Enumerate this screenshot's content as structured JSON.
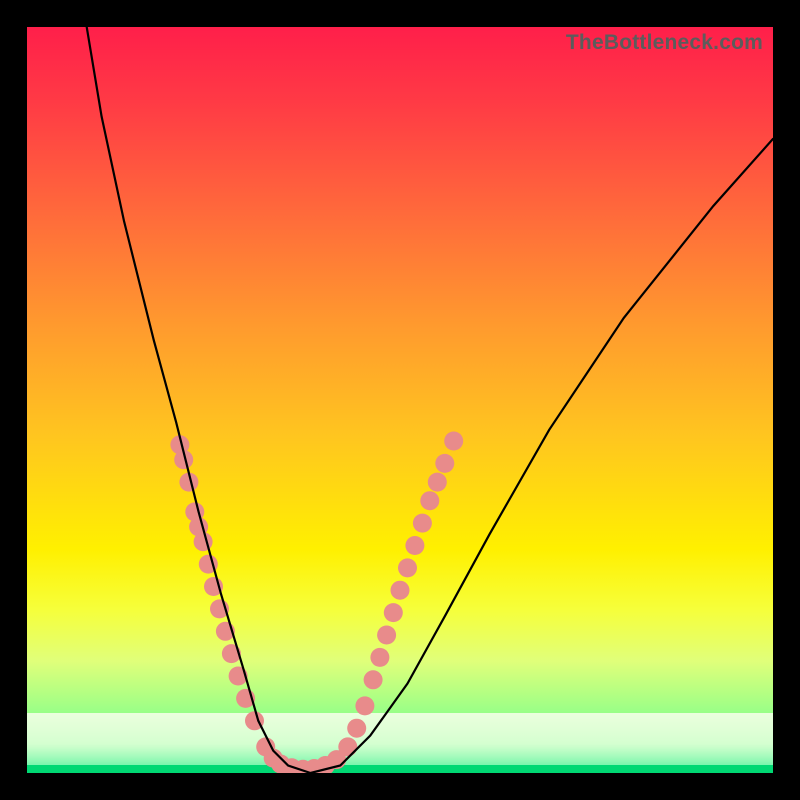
{
  "watermark": {
    "text": "TheBottleneck.com"
  },
  "chart_data": {
    "type": "line",
    "title": "",
    "xlabel": "",
    "ylabel": "",
    "xlim": [
      0,
      100
    ],
    "ylim": [
      0,
      100
    ],
    "grid": false,
    "legend": false,
    "series": [
      {
        "name": "bottleneck-curve",
        "x": [
          8,
          10,
          13,
          17,
          20,
          23,
          26,
          29,
          31,
          33,
          35,
          38,
          42,
          46,
          51,
          56,
          62,
          70,
          80,
          92,
          100
        ],
        "values": [
          100,
          88,
          74,
          58,
          47,
          35,
          24,
          14,
          7,
          3,
          1,
          0,
          1,
          5,
          12,
          21,
          32,
          46,
          61,
          76,
          85
        ]
      }
    ],
    "markers": {
      "name": "highlight-dots",
      "color": "#e88b8b",
      "points": [
        {
          "x": 20.5,
          "y": 44
        },
        {
          "x": 21.0,
          "y": 42
        },
        {
          "x": 21.7,
          "y": 39
        },
        {
          "x": 22.5,
          "y": 35
        },
        {
          "x": 23.0,
          "y": 33
        },
        {
          "x": 23.6,
          "y": 31
        },
        {
          "x": 24.3,
          "y": 28
        },
        {
          "x": 25.0,
          "y": 25
        },
        {
          "x": 25.8,
          "y": 22
        },
        {
          "x": 26.6,
          "y": 19
        },
        {
          "x": 27.4,
          "y": 16
        },
        {
          "x": 28.3,
          "y": 13
        },
        {
          "x": 29.3,
          "y": 10
        },
        {
          "x": 30.5,
          "y": 7
        },
        {
          "x": 32.0,
          "y": 3.5
        },
        {
          "x": 33.0,
          "y": 2.0
        },
        {
          "x": 34.0,
          "y": 1.2
        },
        {
          "x": 35.5,
          "y": 0.7
        },
        {
          "x": 37.0,
          "y": 0.5
        },
        {
          "x": 38.5,
          "y": 0.6
        },
        {
          "x": 40.0,
          "y": 1.0
        },
        {
          "x": 41.5,
          "y": 1.8
        },
        {
          "x": 43.0,
          "y": 3.5
        },
        {
          "x": 44.2,
          "y": 6.0
        },
        {
          "x": 45.3,
          "y": 9.0
        },
        {
          "x": 46.4,
          "y": 12.5
        },
        {
          "x": 47.3,
          "y": 15.5
        },
        {
          "x": 48.2,
          "y": 18.5
        },
        {
          "x": 49.1,
          "y": 21.5
        },
        {
          "x": 50.0,
          "y": 24.5
        },
        {
          "x": 51.0,
          "y": 27.5
        },
        {
          "x": 52.0,
          "y": 30.5
        },
        {
          "x": 53.0,
          "y": 33.5
        },
        {
          "x": 54.0,
          "y": 36.5
        },
        {
          "x": 55.0,
          "y": 39.0
        },
        {
          "x": 56.0,
          "y": 41.5
        },
        {
          "x": 57.2,
          "y": 44.5
        }
      ]
    }
  }
}
